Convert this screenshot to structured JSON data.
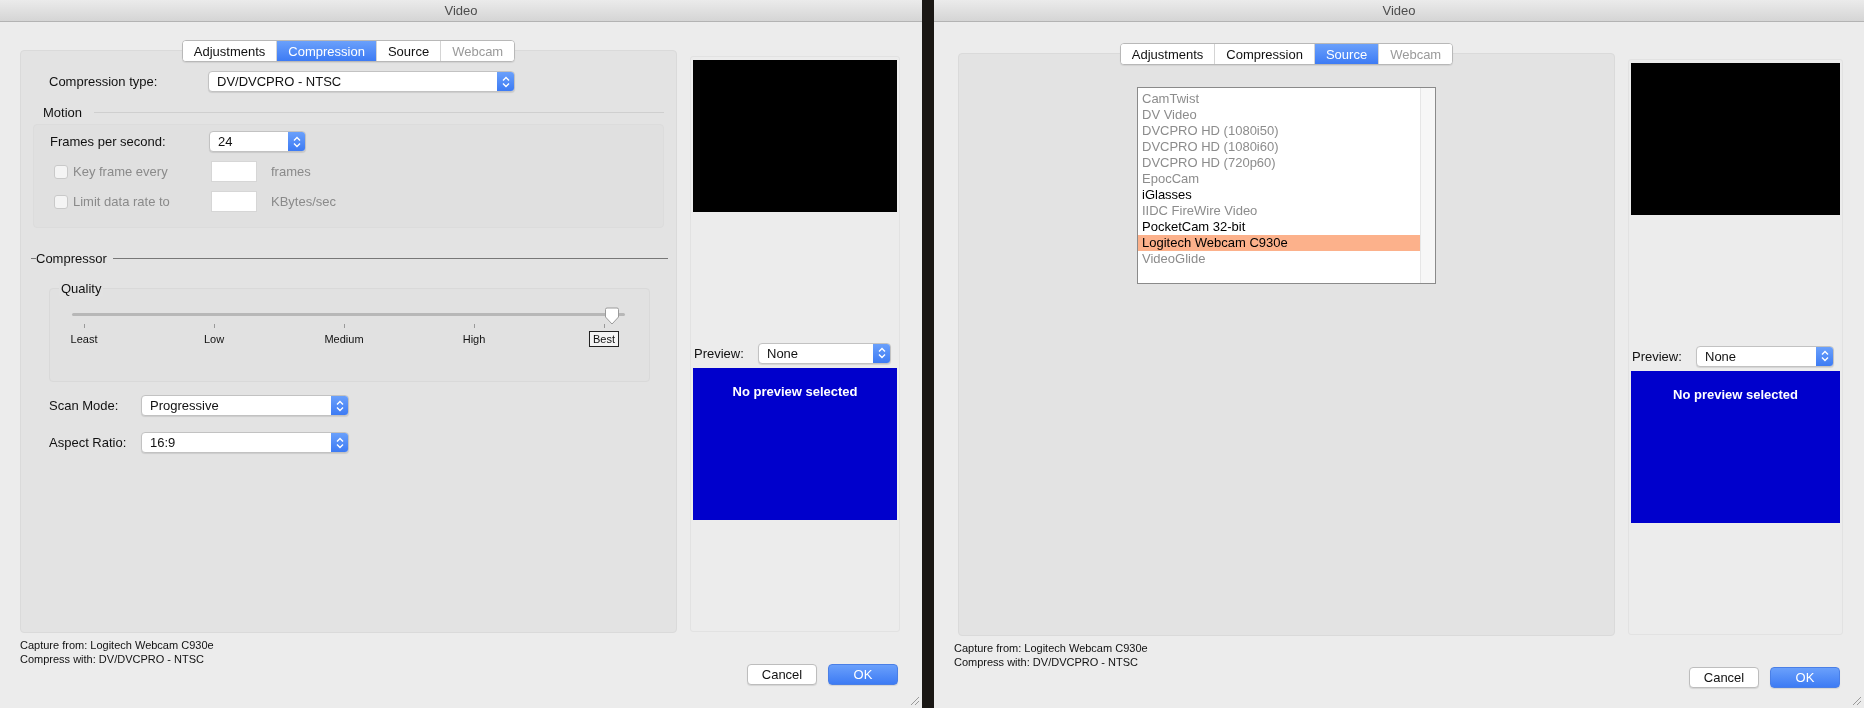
{
  "windows": [
    {
      "title": "Video",
      "tabs": [
        {
          "label": "Adjustments",
          "selected": false,
          "disabled": false
        },
        {
          "label": "Compression",
          "selected": true,
          "disabled": false
        },
        {
          "label": "Source",
          "selected": false,
          "disabled": false
        },
        {
          "label": "Webcam",
          "selected": false,
          "disabled": true
        }
      ],
      "pane": {
        "kind": "compression",
        "compression_type": {
          "label": "Compression type:",
          "value": "DV/DVCPRO - NTSC"
        },
        "motion": {
          "title": "Motion",
          "frames_per_second": {
            "label": "Frames per second:",
            "value": "24"
          },
          "options": [
            {
              "label": "Key frame every",
              "checked": false,
              "disabled": true,
              "unit": "frames"
            },
            {
              "label": "Limit data rate to",
              "checked": false,
              "disabled": true,
              "unit": "KBytes/sec"
            }
          ]
        },
        "compressor": {
          "title": "Compressor",
          "quality": {
            "title": "Quality",
            "level": 1,
            "ticks": [
              {
                "label": "Least",
                "selected": false
              },
              {
                "label": "Low",
                "selected": false
              },
              {
                "label": "Medium",
                "selected": false
              },
              {
                "label": "High",
                "selected": false
              },
              {
                "label": "Best",
                "selected": true
              }
            ]
          }
        },
        "scan_mode": {
          "label": "Scan Mode:",
          "value": "Progressive"
        },
        "aspect_ratio": {
          "label": "Aspect Ratio:",
          "value": "16:9"
        }
      },
      "preview": {
        "label": "Preview:",
        "value": "None",
        "message": "No preview selected"
      },
      "status": [
        "Capture from: Logitech Webcam C930e",
        "Compress with: DV/DVCPRO - NTSC"
      ],
      "buttons": [
        {
          "label": "Cancel",
          "default": false
        },
        {
          "label": "OK",
          "default": true
        }
      ]
    },
    {
      "title": "Video",
      "tabs": [
        {
          "label": "Adjustments",
          "selected": false,
          "disabled": false
        },
        {
          "label": "Compression",
          "selected": false,
          "disabled": false
        },
        {
          "label": "Source",
          "selected": true,
          "disabled": false
        },
        {
          "label": "Webcam",
          "selected": false,
          "disabled": true
        }
      ],
      "pane": {
        "kind": "source",
        "devices": [
          {
            "label": "CamTwist",
            "available": false,
            "selected": false
          },
          {
            "label": "DV Video",
            "available": false,
            "selected": false
          },
          {
            "label": "DVCPRO HD (1080i50)",
            "available": false,
            "selected": false
          },
          {
            "label": "DVCPRO HD (1080i60)",
            "available": false,
            "selected": false
          },
          {
            "label": "DVCPRO HD (720p60)",
            "available": false,
            "selected": false
          },
          {
            "label": "EpocCam",
            "available": false,
            "selected": false
          },
          {
            "label": "iGlasses",
            "available": true,
            "selected": false
          },
          {
            "label": "IIDC FireWire Video",
            "available": false,
            "selected": false
          },
          {
            "label": "PocketCam 32-bit",
            "available": true,
            "selected": false
          },
          {
            "label": "Logitech Webcam C930e",
            "available": true,
            "selected": true
          },
          {
            "label": "VideoGlide",
            "available": false,
            "selected": false
          }
        ]
      },
      "preview": {
        "label": "Preview:",
        "value": "None",
        "message": "No preview selected"
      },
      "status": [
        "Capture from: Logitech Webcam C930e",
        "Compress with: DV/DVCPRO - NTSC"
      ],
      "buttons": [
        {
          "label": "Cancel",
          "default": false
        },
        {
          "label": "OK",
          "default": true
        }
      ]
    }
  ]
}
